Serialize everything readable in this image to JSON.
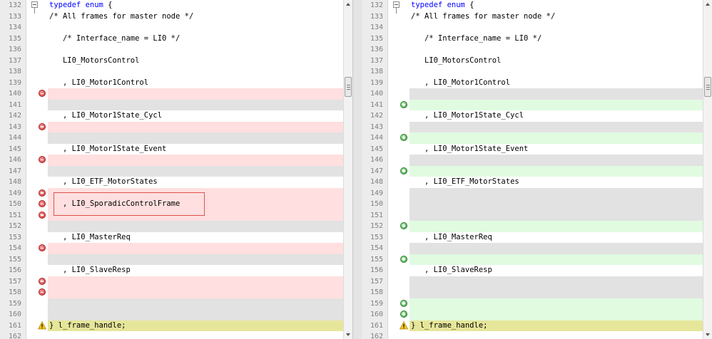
{
  "left_pane": {
    "lines": [
      {
        "num": "132",
        "text": "typedef enum {",
        "type": "normal",
        "style": "keyword",
        "fold": true
      },
      {
        "num": "133",
        "text": "/* All frames for master node */",
        "type": "normal",
        "style": "comment"
      },
      {
        "num": "134",
        "text": "",
        "type": "normal"
      },
      {
        "num": "135",
        "text": "   /* Interface_name = LI0 */",
        "type": "normal",
        "style": "comment"
      },
      {
        "num": "136",
        "text": "",
        "type": "normal"
      },
      {
        "num": "137",
        "text": "   LI0_MotorsControl",
        "type": "normal"
      },
      {
        "num": "138",
        "text": "",
        "type": "normal"
      },
      {
        "num": "139",
        "text": "   , LI0_Motor1Control",
        "type": "normal"
      },
      {
        "num": "140",
        "text": "",
        "type": "removed",
        "marker": "minus"
      },
      {
        "num": "141",
        "text": "",
        "type": "filler"
      },
      {
        "num": "142",
        "text": "   , LI0_Motor1State_Cycl",
        "type": "normal"
      },
      {
        "num": "143",
        "text": "",
        "type": "removed",
        "marker": "minus"
      },
      {
        "num": "144",
        "text": "",
        "type": "filler"
      },
      {
        "num": "145",
        "text": "   , LI0_Motor1State_Event",
        "type": "normal"
      },
      {
        "num": "146",
        "text": "",
        "type": "removed",
        "marker": "minus"
      },
      {
        "num": "147",
        "text": "",
        "type": "filler"
      },
      {
        "num": "148",
        "text": "   , LI0_ETF_MotorStates",
        "type": "normal"
      },
      {
        "num": "149",
        "text": "",
        "type": "removed",
        "marker": "minus"
      },
      {
        "num": "150",
        "text": "   , LI0_SporadicControlFrame",
        "type": "removed",
        "marker": "minus"
      },
      {
        "num": "151",
        "text": "",
        "type": "removed",
        "marker": "minus"
      },
      {
        "num": "152",
        "text": "",
        "type": "filler"
      },
      {
        "num": "153",
        "text": "   , LI0_MasterReq",
        "type": "normal"
      },
      {
        "num": "154",
        "text": "",
        "type": "removed",
        "marker": "minus"
      },
      {
        "num": "155",
        "text": "",
        "type": "filler"
      },
      {
        "num": "156",
        "text": "   , LI0_SlaveResp",
        "type": "normal"
      },
      {
        "num": "157",
        "text": "",
        "type": "removed",
        "marker": "minus"
      },
      {
        "num": "158",
        "text": "",
        "type": "removed",
        "marker": "minus"
      },
      {
        "num": "159",
        "text": "",
        "type": "filler"
      },
      {
        "num": "160",
        "text": "",
        "type": "filler"
      },
      {
        "num": "161",
        "text": "} l_frame_handle;",
        "type": "warn",
        "marker": "warning"
      },
      {
        "num": "162",
        "text": "",
        "type": "normal"
      }
    ]
  },
  "right_pane": {
    "lines": [
      {
        "num": "132",
        "text": "typedef enum {",
        "type": "normal",
        "style": "keyword",
        "fold": true
      },
      {
        "num": "133",
        "text": "/* All frames for master node */",
        "type": "normal",
        "style": "comment"
      },
      {
        "num": "134",
        "text": "",
        "type": "normal"
      },
      {
        "num": "135",
        "text": "   /* Interface_name = LI0 */",
        "type": "normal",
        "style": "comment"
      },
      {
        "num": "136",
        "text": "",
        "type": "normal"
      },
      {
        "num": "137",
        "text": "   LI0_MotorsControl",
        "type": "normal"
      },
      {
        "num": "138",
        "text": "",
        "type": "normal"
      },
      {
        "num": "139",
        "text": "   , LI0_Motor1Control",
        "type": "normal"
      },
      {
        "num": "140",
        "text": "",
        "type": "filler"
      },
      {
        "num": "141",
        "text": "",
        "type": "added",
        "marker": "plus"
      },
      {
        "num": "142",
        "text": "   , LI0_Motor1State_Cycl",
        "type": "normal"
      },
      {
        "num": "143",
        "text": "",
        "type": "filler"
      },
      {
        "num": "144",
        "text": "",
        "type": "added",
        "marker": "plus"
      },
      {
        "num": "145",
        "text": "   , LI0_Motor1State_Event",
        "type": "normal"
      },
      {
        "num": "146",
        "text": "",
        "type": "filler"
      },
      {
        "num": "147",
        "text": "",
        "type": "added",
        "marker": "plus"
      },
      {
        "num": "148",
        "text": "   , LI0_ETF_MotorStates",
        "type": "normal"
      },
      {
        "num": "149",
        "text": "",
        "type": "filler"
      },
      {
        "num": "150",
        "text": "",
        "type": "filler"
      },
      {
        "num": "151",
        "text": "",
        "type": "filler"
      },
      {
        "num": "152",
        "text": "",
        "type": "added",
        "marker": "plus"
      },
      {
        "num": "153",
        "text": "   , LI0_MasterReq",
        "type": "normal"
      },
      {
        "num": "154",
        "text": "",
        "type": "filler"
      },
      {
        "num": "155",
        "text": "",
        "type": "added",
        "marker": "plus"
      },
      {
        "num": "156",
        "text": "   , LI0_SlaveResp",
        "type": "normal"
      },
      {
        "num": "157",
        "text": "",
        "type": "filler"
      },
      {
        "num": "158",
        "text": "",
        "type": "filler"
      },
      {
        "num": "159",
        "text": "",
        "type": "added",
        "marker": "plus"
      },
      {
        "num": "160",
        "text": "",
        "type": "added",
        "marker": "plus"
      },
      {
        "num": "161",
        "text": "} l_frame_handle;",
        "type": "warn",
        "marker": "warning"
      },
      {
        "num": "162",
        "text": "",
        "type": "normal"
      }
    ]
  },
  "colors": {
    "removed": "#ffdfdf",
    "added": "#e0fbe0",
    "filler": "#e2e2e2",
    "warning": "#e6e69a",
    "keyword": "#0000ff",
    "comment": "#008000",
    "highlight_border": "#e05050"
  },
  "icons": {
    "removed_marker": "minus-circle-icon",
    "added_marker": "plus-circle-icon",
    "warning_marker": "warning-triangle-icon",
    "fold": "fold-collapse-icon"
  }
}
